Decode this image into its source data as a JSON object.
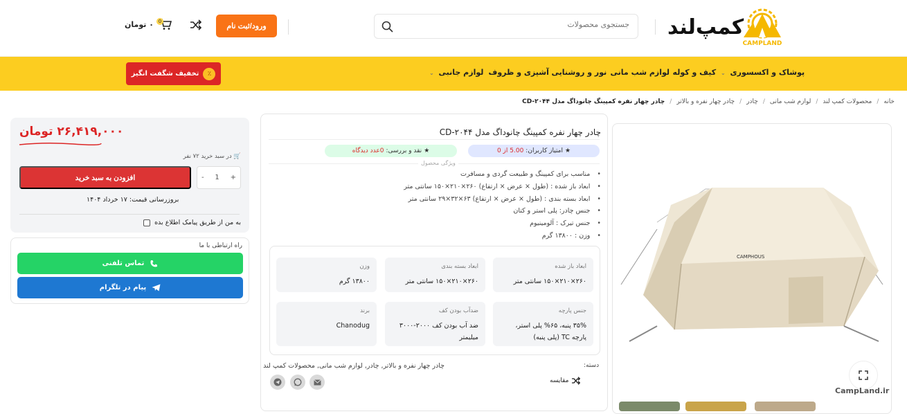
{
  "header": {
    "logo_text": "کمپ‌لند",
    "logo_sub": "CAMPLAND",
    "search_placeholder": "جستجوی محصولات",
    "login_label": "ورود/ثبت نام",
    "cart_badge": "0",
    "cart_total": "۰ تومان"
  },
  "nav": {
    "items": [
      {
        "label": "پوشاک و اکسسوری"
      },
      {
        "label": "کیف و کوله"
      },
      {
        "label": "لوازم شب مانی"
      },
      {
        "label": "نور و روشنایی"
      },
      {
        "label": "آشپزی و ظروف"
      },
      {
        "label": "لوازم جانبی"
      }
    ],
    "deal_label": "تخفیف شگفت انگیز",
    "deal_icon": "٪"
  },
  "breadcrumb": [
    "خانه",
    "محصولات کمپ لند",
    "لوازم شب مانی",
    "چادر",
    "چادر چهار نفره و بالاتر",
    "چادر چهار نفره کمپینگ چانوداگ مدل CD-۲۰۴۴"
  ],
  "gallery": {
    "watermark": "CampLand.ir",
    "tent_brand": "CAMPHOUS"
  },
  "product": {
    "title": "چادر چهار نفره کمپینگ چانوداگ مدل CD-۲۰۴۴",
    "rating_prefix": "امتیاز کاربران:",
    "rating_value": "5.00 از 0",
    "review_prefix": "نقد و بررسی:",
    "review_value": "0عدد دیدگاه",
    "features_label": "ویژگی محصول",
    "features": [
      "مناسب برای کمپینگ و طبیعت گردی و مسافرت",
      "ابعاد باز شده : (طول × عرض × ارتفاع) ۲۶۰×۲۱۰×۱۵۰ سانتی متر",
      "ابعاد بسته بندی : (طول × عرض × ارتفاع) ۶۳×۳۲×۲۹ سانتی متر",
      "جنس چادر: پلی استر و کتان",
      "جنس تیرک : آلومینیوم",
      "وزن : ۱۳۸۰۰ گرم"
    ],
    "specs": [
      {
        "label": "ابعاد باز شده",
        "value": "۲۶۰×۲۱۰×۱۵۰ سانتی متر"
      },
      {
        "label": "ابعاد بسته بندی",
        "value": "۲۶۰×۲۱۰×۱۵۰ سانتی متر"
      },
      {
        "label": "وزن",
        "value": "۱۳۸۰۰ گرم"
      },
      {
        "label": "جنس پارچه",
        "value": "۳۵% پنبه، ۶۵% پلی استر، پارچه TC (پلی پنبه)"
      },
      {
        "label": "ضدآب بودن کف",
        "value": "ضد آب بودن کف ۲۰۰۰-۳۰۰۰ میلیمتر"
      },
      {
        "label": "برند",
        "value": "Chanodug"
      }
    ],
    "category_label": "دسته:",
    "category_value": "چادر چهار نفره و بالاتر, چادر, لوازم شب مانی, محصولات کمپ لند",
    "compare_label": "مقایسه"
  },
  "buy": {
    "price": "۲۶,۴۱۹,۰۰۰ تومان",
    "cart_count": "در سبد خرید ۷۲ نفر",
    "qty_minus": "-",
    "qty_value": "1",
    "qty_plus": "+",
    "add_to_cart": "افزودن به سبد خرید",
    "price_update": "بروزرسانی قیمت: ۱۷ خرداد ۱۴۰۴",
    "sms_label": "به من از طریق پیامک اطلاع بده"
  },
  "contact": {
    "label": "راه ارتباطی با ما",
    "call_label": "تماس تلفنی",
    "telegram_label": "پیام در تلگرام"
  },
  "colors": {
    "nav_yellow": "#fccd20",
    "accent_orange": "#f97316",
    "price_red": "#dc2626",
    "whatsapp_green": "#25d366",
    "telegram_blue": "#1e78d2"
  }
}
